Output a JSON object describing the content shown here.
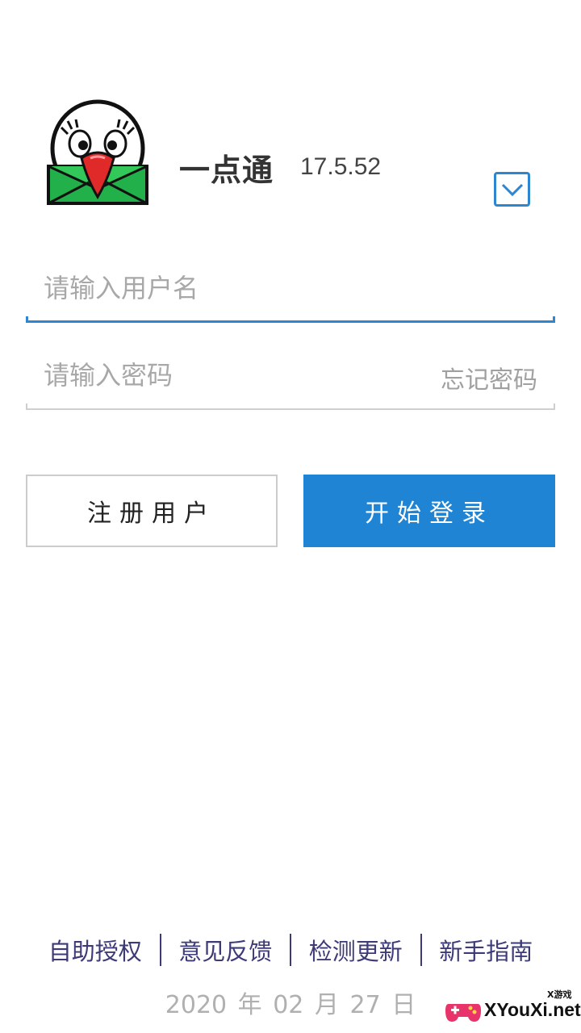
{
  "app": {
    "name": "一点通",
    "version": "17.5.52"
  },
  "login_form": {
    "username_placeholder": "请输入用户名",
    "password_placeholder": "请输入密码",
    "forgot_password": "忘记密码"
  },
  "buttons": {
    "register": "注册用户",
    "login": "开始登录"
  },
  "footer": {
    "links": [
      "自助授权",
      "意见反馈",
      "检测更新",
      "新手指南"
    ],
    "date": {
      "year": "2020",
      "year_unit": "年",
      "month": "02",
      "month_unit": "月",
      "day": "27",
      "day_unit": "日"
    }
  },
  "watermark": {
    "badge": "X游戏",
    "site": "XYouXi.net"
  },
  "colors": {
    "accent": "#1f84d4",
    "link": "#3d3a78"
  },
  "icons": {
    "logo": "parrot-envelope-logo",
    "dropdown": "chevron-down-icon"
  }
}
